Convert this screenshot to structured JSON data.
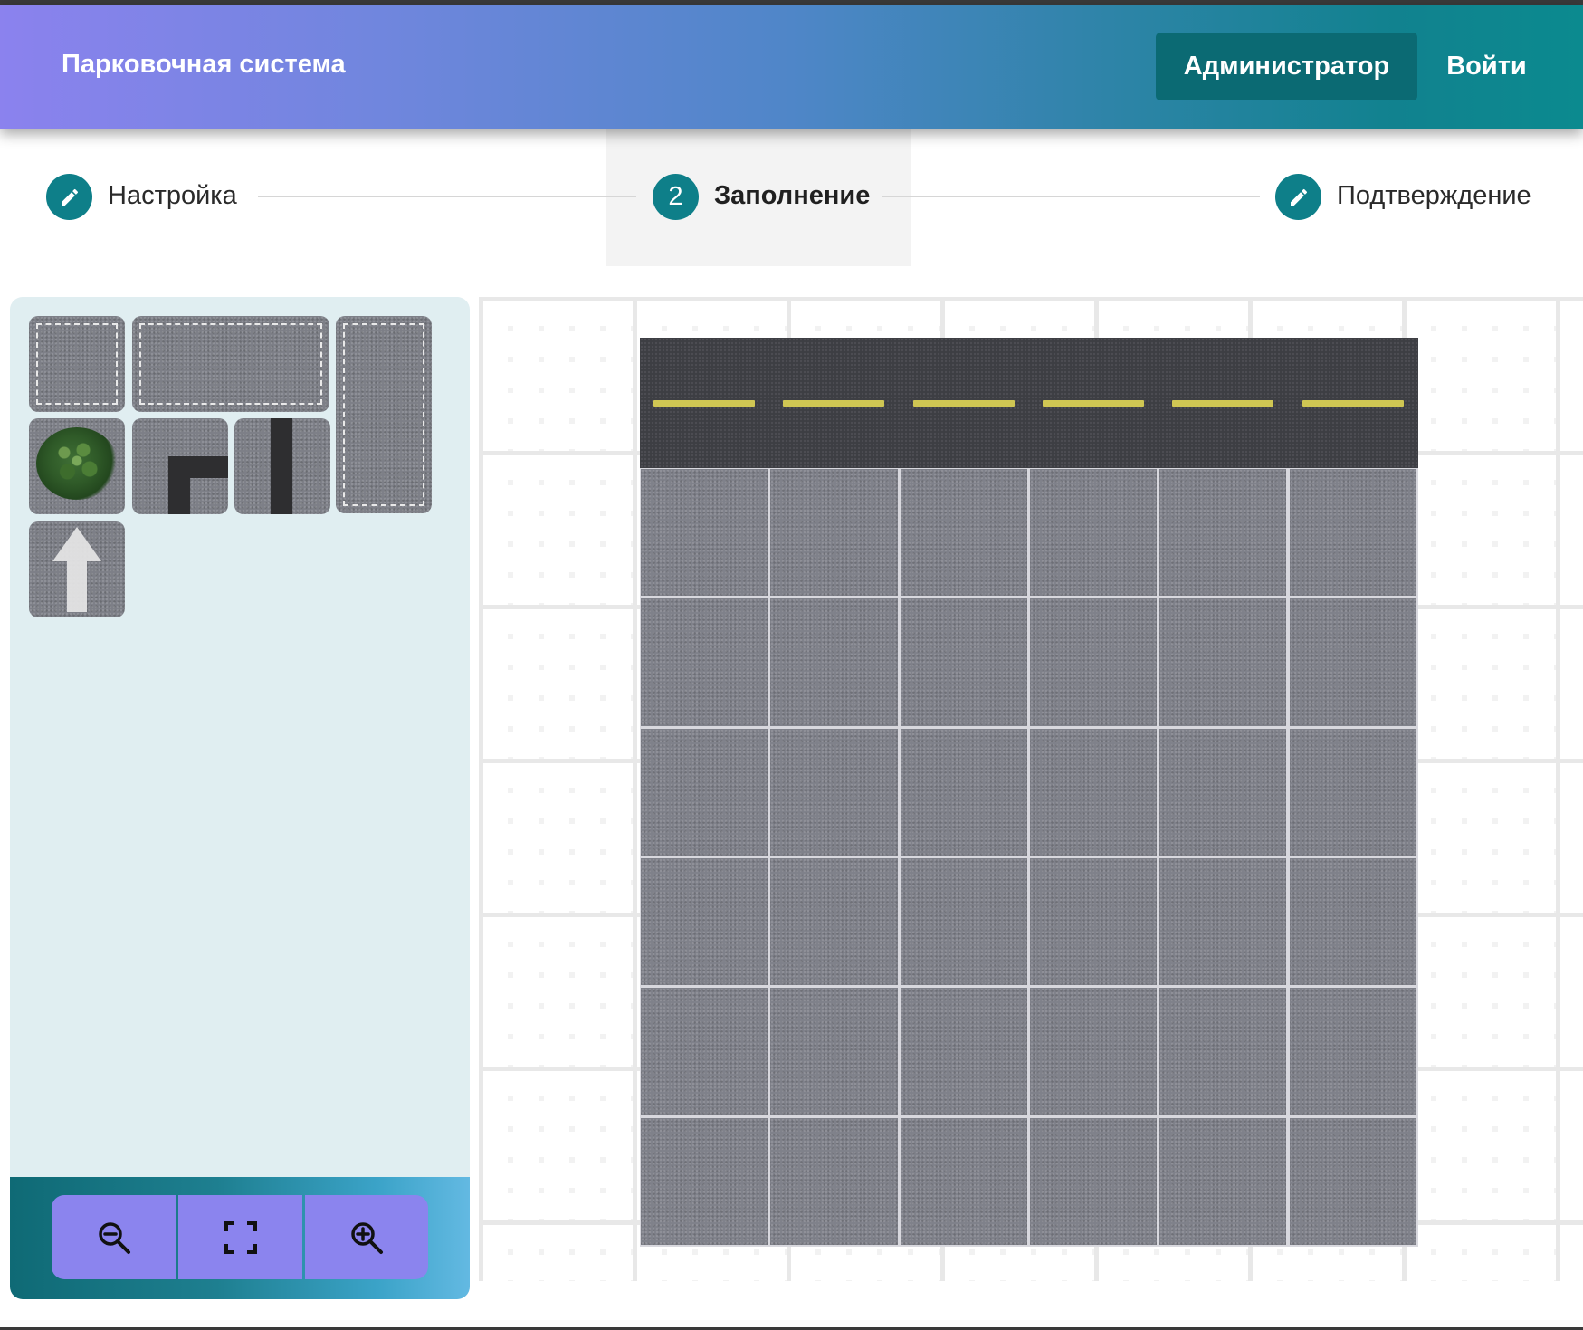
{
  "app": {
    "title": "Парковочная система",
    "admin_label": "Администратор",
    "login_label": "Войти",
    "accent_color": "#0e7f89"
  },
  "stepper": {
    "steps": [
      {
        "label": "Настройка",
        "icon": "pencil-icon",
        "state": "edit"
      },
      {
        "label": "Заполнение",
        "number": "2",
        "state": "active"
      },
      {
        "label": "Подтверждение",
        "icon": "pencil-icon",
        "state": "edit"
      }
    ]
  },
  "palette": {
    "tiles": [
      "parking-spot-small",
      "parking-spot-wide",
      "parking-spot-tall",
      "bush",
      "wall-corner",
      "wall-vertical",
      "arrow-up"
    ],
    "toolbar": {
      "buttons": [
        "zoom-out-icon",
        "fit-screen-icon",
        "zoom-in-icon"
      ]
    }
  },
  "map": {
    "rows": 6,
    "cols": 6,
    "road": {
      "lane_color": "#cfc653",
      "lane_dashes": 6
    }
  }
}
